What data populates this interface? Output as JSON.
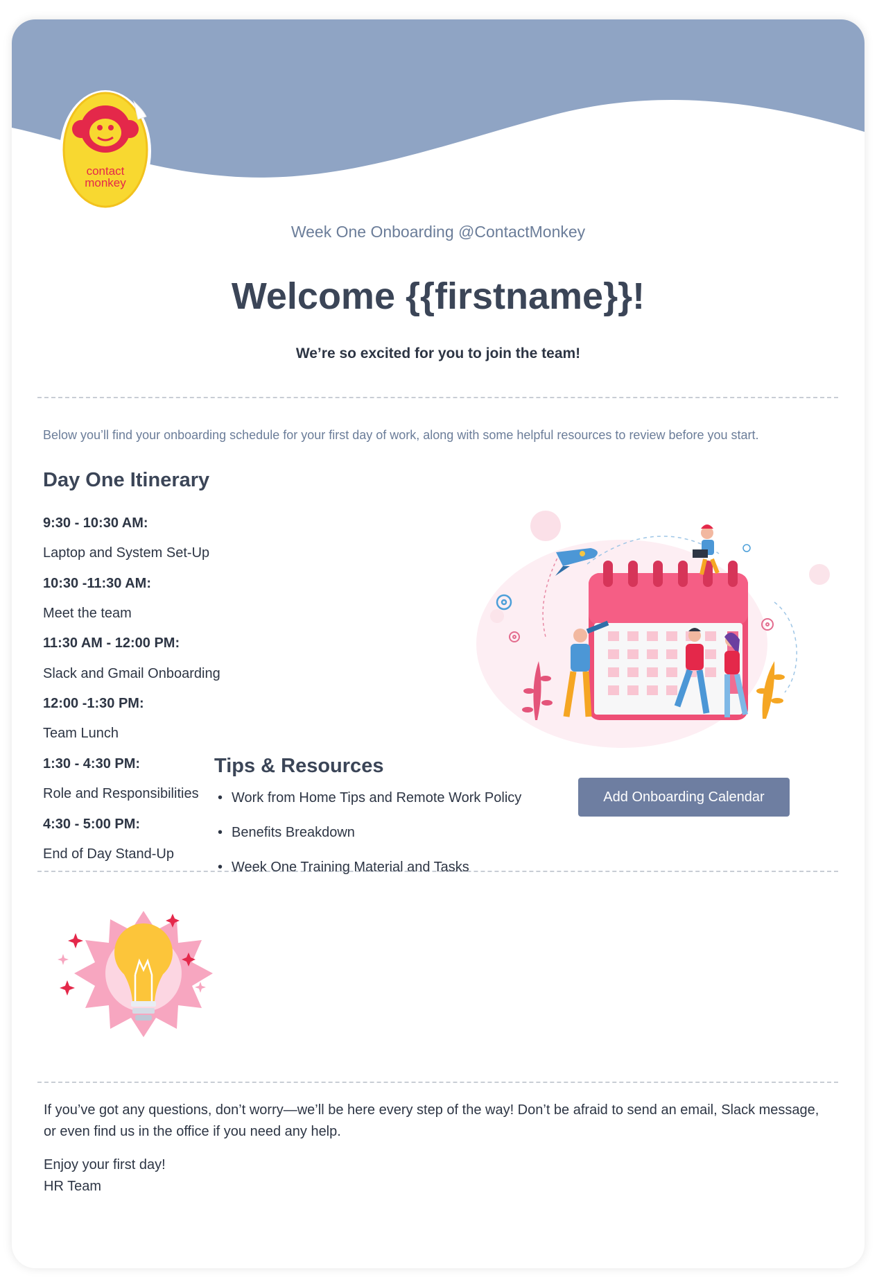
{
  "brand": {
    "name": "ContactMonkey",
    "logo_text_line1": "contact",
    "logo_text_line2": "monkey",
    "banner_color": "#8fa4c4",
    "logo_yellow": "#f8d830",
    "logo_red": "#e4284a"
  },
  "header": {
    "subtitle": "Week One Onboarding @ContactMonkey",
    "title": "Welcome {{firstname}}!",
    "tagline": "We’re so excited for you to join the team!"
  },
  "intro": "Below you’ll find your onboarding schedule for your first day of work, along with some helpful resources to review before you start.",
  "itinerary": {
    "heading": "Day One Itinerary",
    "items": [
      {
        "time": "9:30 - 10:30 AM:",
        "activity": "Laptop and System Set-Up"
      },
      {
        "time": "10:30 -11:30 AM:",
        "activity": "Meet the team"
      },
      {
        "time": "11:30 AM - 12:00 PM:",
        "activity": "Slack and Gmail Onboarding"
      },
      {
        "time": "12:00 -1:30 PM:",
        "activity": "Team Lunch"
      },
      {
        "time": "1:30 - 4:30 PM:",
        "activity": "Role and Responsibilities"
      },
      {
        "time": "4:30 - 5:00 PM:",
        "activity": "End of Day Stand-Up"
      }
    ],
    "illustration_icon": "calendar-people-illustration",
    "calendar_button": "Add Onboarding Calendar",
    "button_color": "#6e7ea1"
  },
  "tips": {
    "heading": "Tips & Resources",
    "icon": "lightbulb-icon",
    "items": [
      "Work from Home Tips and Remote Work Policy",
      "Benefits Breakdown",
      "Week One Training Material and Tasks"
    ]
  },
  "closing": {
    "message": "If you’ve got any questions, don’t worry—we’ll be here every step of the way! Don’t be afraid to send an email, Slack message, or even find us in the office if you need any help.",
    "signoff_line1": "Enjoy your first day!",
    "signoff_line2": "HR Team"
  }
}
